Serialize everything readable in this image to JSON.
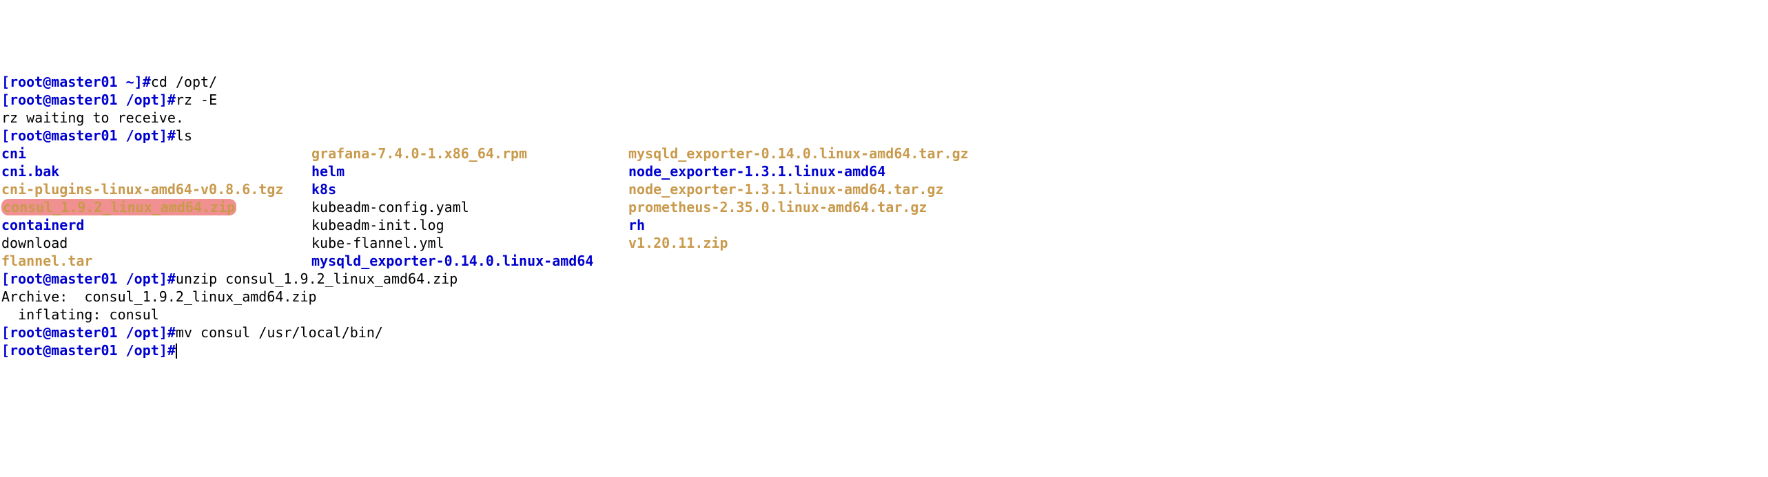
{
  "lines": {
    "prompt1": {
      "user": "root",
      "host": "master01",
      "path": "~",
      "cmd": "cd /opt/"
    },
    "prompt2": {
      "user": "root",
      "host": "master01",
      "path": "/opt",
      "cmd": "rz -E"
    },
    "rz_wait": "rz waiting to receive.",
    "prompt3": {
      "user": "root",
      "host": "master01",
      "path": "/opt",
      "cmd": "ls"
    },
    "ls": {
      "col1": [
        {
          "text": "cni",
          "style": "blue bold"
        },
        {
          "text": "cni.bak",
          "style": "blue bold"
        },
        {
          "text": "cni-plugins-linux-amd64-v0.8.6.tgz",
          "style": "tan bold"
        },
        {
          "text": "consul_1.9.2_linux_amd64.zip",
          "style": "tan bold",
          "highlight": true
        },
        {
          "text": "containerd",
          "style": "blue bold"
        },
        {
          "text": "download",
          "style": "black"
        },
        {
          "text": "flannel.tar",
          "style": "tan bold"
        }
      ],
      "col2": [
        {
          "text": "grafana-7.4.0-1.x86_64.rpm",
          "style": "tan bold"
        },
        {
          "text": "helm",
          "style": "blue bold"
        },
        {
          "text": "k8s",
          "style": "blue bold"
        },
        {
          "text": "kubeadm-config.yaml",
          "style": "black"
        },
        {
          "text": "kubeadm-init.log",
          "style": "black"
        },
        {
          "text": "kube-flannel.yml",
          "style": "black"
        },
        {
          "text": "mysqld_exporter-0.14.0.linux-amd64",
          "style": "blue bold"
        }
      ],
      "col3": [
        {
          "text": "mysqld_exporter-0.14.0.linux-amd64.tar.gz",
          "style": "tan bold"
        },
        {
          "text": "node_exporter-1.3.1.linux-amd64",
          "style": "blue bold"
        },
        {
          "text": "node_exporter-1.3.1.linux-amd64.tar.gz",
          "style": "tan bold"
        },
        {
          "text": "prometheus-2.35.0.linux-amd64.tar.gz",
          "style": "tan bold"
        },
        {
          "text": "rh",
          "style": "blue bold"
        },
        {
          "text": "v1.20.11.zip",
          "style": "tan bold"
        }
      ]
    },
    "prompt4": {
      "user": "root",
      "host": "master01",
      "path": "/opt",
      "cmd": "unzip consul_1.9.2_linux_amd64.zip"
    },
    "archive": "Archive:  consul_1.9.2_linux_amd64.zip",
    "inflating": "  inflating: consul",
    "prompt5": {
      "user": "root",
      "host": "master01",
      "path": "/opt",
      "cmd": "mv consul /usr/local/bin/"
    },
    "prompt6": {
      "user": "root",
      "host": "master01",
      "path": "/opt",
      "cmd": ""
    }
  }
}
